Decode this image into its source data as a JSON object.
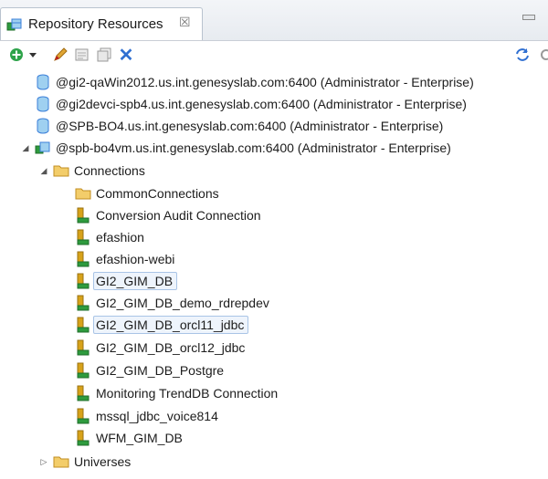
{
  "view": {
    "tab_title": "Repository Resources",
    "tab_close": "☒"
  },
  "toolbar": {
    "icons": [
      "add-icon",
      "dropdown-arrow-icon",
      "edit-icon",
      "properties-icon",
      "copy-icon",
      "delete-icon",
      "refresh-icon"
    ],
    "delete_glyph": "✕"
  },
  "tree": {
    "servers": [
      {
        "label": "@gi2-qaWin2012.us.int.genesyslab.com:6400 (Administrator - Enterprise)",
        "expanded": false
      },
      {
        "label": "@gi2devci-spb4.us.int.genesyslab.com:6400 (Administrator - Enterprise)",
        "expanded": false
      },
      {
        "label": "@SPB-BO4.us.int.genesyslab.com:6400 (Administrator - Enterprise)",
        "expanded": false
      },
      {
        "label": "@spb-bo4vm.us.int.genesyslab.com:6400 (Administrator - Enterprise)",
        "expanded": true
      }
    ],
    "connections_folder": "Connections",
    "common_connections": "CommonConnections",
    "connections": [
      {
        "label": "Conversion Audit Connection",
        "selected": false
      },
      {
        "label": "efashion",
        "selected": false
      },
      {
        "label": "efashion-webi",
        "selected": false
      },
      {
        "label": "GI2_GIM_DB",
        "selected": true
      },
      {
        "label": "GI2_GIM_DB_demo_rdrepdev",
        "selected": false
      },
      {
        "label": "GI2_GIM_DB_orcl11_jdbc",
        "selected": true
      },
      {
        "label": "GI2_GIM_DB_orcl12_jdbc",
        "selected": false
      },
      {
        "label": "GI2_GIM_DB_Postgre",
        "selected": false
      },
      {
        "label": "Monitoring TrendDB Connection",
        "selected": false
      },
      {
        "label": "mssql_jdbc_voice814",
        "selected": false
      },
      {
        "label": "WFM_GIM_DB",
        "selected": false
      }
    ],
    "universes_folder": "Universes",
    "expanded_glyph": "◢",
    "collapsed_glyph": "▷"
  },
  "colors": {
    "folder": "#e8b64a",
    "db_blue": "#3b7fd9",
    "connection_gold": "#d7a21a",
    "connection_green": "#2e9b3e",
    "add_green": "#2ea34a",
    "delete_blue": "#2f6fd1",
    "selection_border": "#a9c4e6"
  }
}
